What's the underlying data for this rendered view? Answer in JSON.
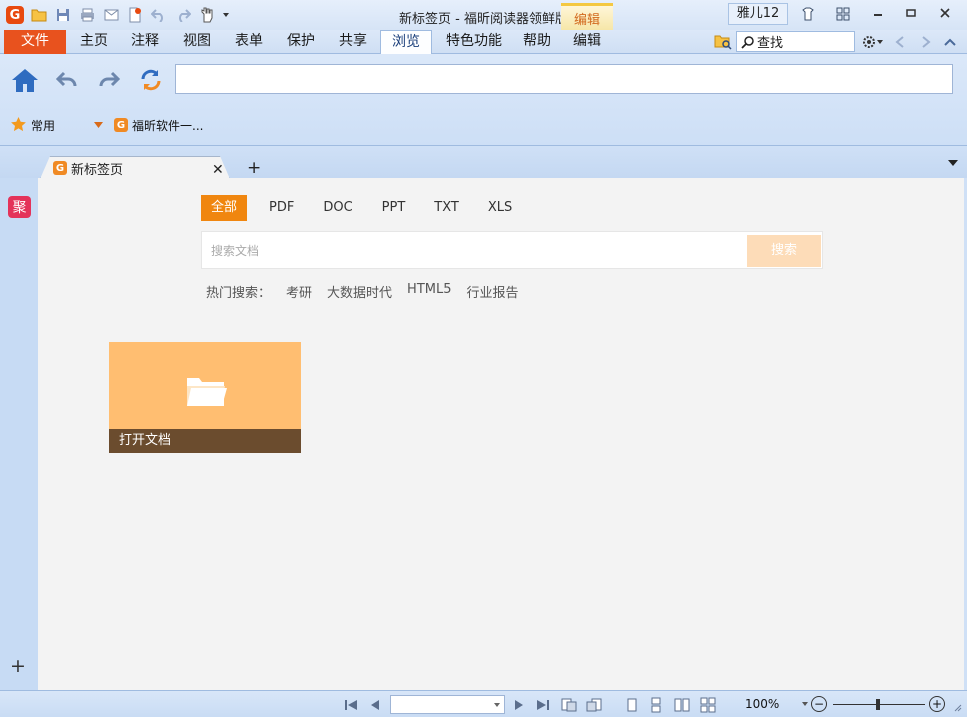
{
  "window": {
    "title": "新标签页 - 福昕阅读器领鲜版",
    "app_logo": "G",
    "user": "雅儿12"
  },
  "context_tab_group": "编辑",
  "menu": {
    "file": "文件",
    "tabs": [
      "主页",
      "注释",
      "视图",
      "表单",
      "保护",
      "共享",
      "浏览",
      "特色功能",
      "帮助",
      "编辑"
    ],
    "active": "浏览"
  },
  "search": {
    "value": "查找"
  },
  "browser": {
    "address_value": "",
    "favorites": {
      "common": "常用",
      "site": "福昕软件一..."
    }
  },
  "tabs": {
    "doc_tab_title": "新标签页"
  },
  "sidebar": {
    "ju_label": "聚"
  },
  "new_tab_page": {
    "filter_tabs": [
      "全部",
      "PDF",
      "DOC",
      "PPT",
      "TXT",
      "XLS"
    ],
    "active_filter": "全部",
    "search_placeholder": "搜索文档",
    "search_button": "搜索",
    "hot_label": "热门搜索：",
    "hot_terms": [
      "考研",
      "大数据时代",
      "HTML5",
      "行业报告"
    ],
    "open_tile_label": "打开文档"
  },
  "status": {
    "page_value": "",
    "zoom": "100%"
  },
  "colors": {
    "accent_orange": "#f0860f",
    "file_tab": "#e8521e",
    "ju_red": "#e4335a",
    "tile": "#ffbe71",
    "tile_bar": "#6b4c2e"
  }
}
